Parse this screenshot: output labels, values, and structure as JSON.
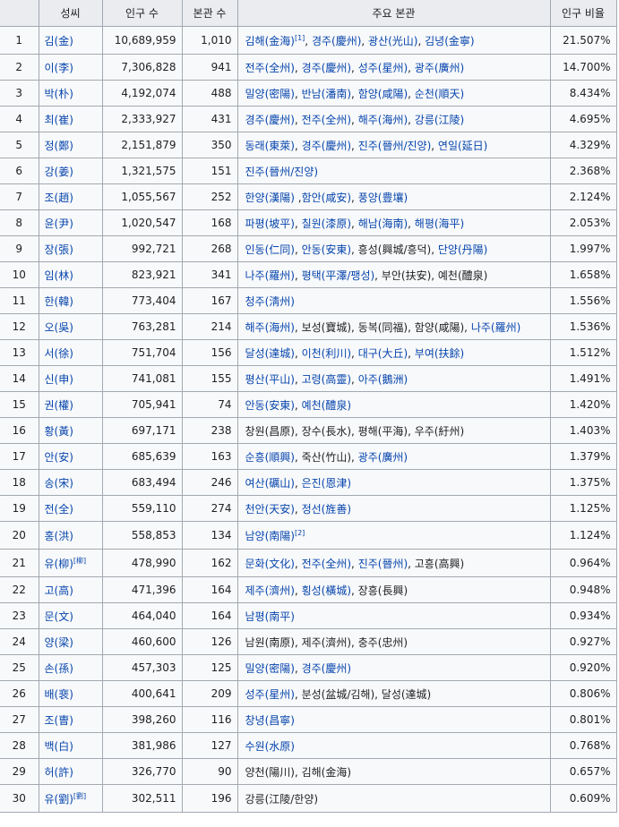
{
  "headers": {
    "name": "성씨",
    "population": "인구 수",
    "bongwan_count": "본관 수",
    "main_bongwan": "주요 본관",
    "ratio": "인구 비율"
  },
  "rows": [
    {
      "rank": "1",
      "name": "김(金)",
      "name_link": true,
      "pop": "10,689,959",
      "bon": "1,010",
      "ratio": "21.507%",
      "main": [
        {
          "t": "김해(金海)",
          "l": true,
          "sup": "[1]"
        },
        {
          "t": ", ",
          "l": false
        },
        {
          "t": "경주(慶州)",
          "l": true
        },
        {
          "t": ", ",
          "l": false
        },
        {
          "t": "광산(光山)",
          "l": true
        },
        {
          "t": ", ",
          "l": false
        },
        {
          "t": "김녕(金寧)",
          "l": true
        }
      ]
    },
    {
      "rank": "2",
      "name": "이(李)",
      "name_link": true,
      "pop": "7,306,828",
      "bon": "941",
      "ratio": "14.700%",
      "main": [
        {
          "t": "전주(全州)",
          "l": true
        },
        {
          "t": ", ",
          "l": false
        },
        {
          "t": "경주(慶州)",
          "l": true
        },
        {
          "t": ", ",
          "l": false
        },
        {
          "t": "성주(星州)",
          "l": true
        },
        {
          "t": ", ",
          "l": false
        },
        {
          "t": "광주(廣州)",
          "l": true
        }
      ]
    },
    {
      "rank": "3",
      "name": "박(朴)",
      "name_link": true,
      "pop": "4,192,074",
      "bon": "488",
      "ratio": "8.434%",
      "main": [
        {
          "t": "밀양(密陽)",
          "l": true
        },
        {
          "t": ", ",
          "l": false
        },
        {
          "t": "반남(潘南)",
          "l": true
        },
        {
          "t": ", ",
          "l": false
        },
        {
          "t": "함양(咸陽)",
          "l": true
        },
        {
          "t": ", ",
          "l": false
        },
        {
          "t": "순천(順天)",
          "l": true
        }
      ]
    },
    {
      "rank": "4",
      "name": "최(崔)",
      "name_link": true,
      "pop": "2,333,927",
      "bon": "431",
      "ratio": "4.695%",
      "main": [
        {
          "t": "경주(慶州)",
          "l": true
        },
        {
          "t": ", ",
          "l": false
        },
        {
          "t": "전주(全州)",
          "l": true
        },
        {
          "t": ", ",
          "l": false
        },
        {
          "t": "해주(海州)",
          "l": true
        },
        {
          "t": ", ",
          "l": false
        },
        {
          "t": "강릉(江陵)",
          "l": true
        }
      ]
    },
    {
      "rank": "5",
      "name": "정(鄭)",
      "name_link": true,
      "pop": "2,151,879",
      "bon": "350",
      "ratio": "4.329%",
      "main": [
        {
          "t": "동래(東萊)",
          "l": true
        },
        {
          "t": ", ",
          "l": false
        },
        {
          "t": "경주(慶州)",
          "l": true
        },
        {
          "t": ", ",
          "l": false
        },
        {
          "t": "진주(晉州/진양)",
          "l": true
        },
        {
          "t": ", ",
          "l": false
        },
        {
          "t": "연일(延日)",
          "l": true
        }
      ]
    },
    {
      "rank": "6",
      "name": "강(姜)",
      "name_link": true,
      "pop": "1,321,575",
      "bon": "151",
      "ratio": "2.368%",
      "main": [
        {
          "t": "진주(晉州/진양)",
          "l": true
        }
      ]
    },
    {
      "rank": "7",
      "name": "조(趙)",
      "name_link": true,
      "pop": "1,055,567",
      "bon": "252",
      "ratio": "2.124%",
      "main": [
        {
          "t": "한양(漢陽)",
          "l": true
        },
        {
          "t": " ,",
          "l": false
        },
        {
          "t": "함안(咸安)",
          "l": true
        },
        {
          "t": ", ",
          "l": false
        },
        {
          "t": "풍양(豊壤)",
          "l": true
        }
      ]
    },
    {
      "rank": "8",
      "name": "윤(尹)",
      "name_link": true,
      "pop": "1,020,547",
      "bon": "168",
      "ratio": "2.053%",
      "main": [
        {
          "t": "파평(坡平)",
          "l": true
        },
        {
          "t": ", ",
          "l": false
        },
        {
          "t": "칠원(漆原)",
          "l": true
        },
        {
          "t": ", ",
          "l": false
        },
        {
          "t": "해남(海南)",
          "l": true
        },
        {
          "t": ", ",
          "l": false
        },
        {
          "t": "해평(海平)",
          "l": true
        }
      ]
    },
    {
      "rank": "9",
      "name": "장(張)",
      "name_link": true,
      "pop": "992,721",
      "bon": "268",
      "ratio": "1.997%",
      "main": [
        {
          "t": "인동(仁同)",
          "l": true
        },
        {
          "t": ", ",
          "l": false
        },
        {
          "t": "안동(安東)",
          "l": true
        },
        {
          "t": ", 흥성(興城/흥덕), ",
          "l": false
        },
        {
          "t": "단양(丹陽)",
          "l": true
        }
      ]
    },
    {
      "rank": "10",
      "name": "임(林)",
      "name_link": true,
      "pop": "823,921",
      "bon": "341",
      "ratio": "1.658%",
      "main": [
        {
          "t": "나주(羅州)",
          "l": true
        },
        {
          "t": ", ",
          "l": false
        },
        {
          "t": "평택(平澤/팽성)",
          "l": true
        },
        {
          "t": ", 부안(扶安), 예천(醴泉)",
          "l": false
        }
      ]
    },
    {
      "rank": "11",
      "name": "한(韓)",
      "name_link": true,
      "pop": "773,404",
      "bon": "167",
      "ratio": "1.556%",
      "main": [
        {
          "t": "청주(淸州)",
          "l": true
        }
      ]
    },
    {
      "rank": "12",
      "name": "오(吳)",
      "name_link": true,
      "pop": "763,281",
      "bon": "214",
      "ratio": "1.536%",
      "main": [
        {
          "t": "해주(海州)",
          "l": true
        },
        {
          "t": ", 보성(寶城), 동복(同福), 함양(咸陽), ",
          "l": false
        },
        {
          "t": "나주(羅州)",
          "l": true
        }
      ]
    },
    {
      "rank": "13",
      "name": "서(徐)",
      "name_link": true,
      "pop": "751,704",
      "bon": "156",
      "ratio": "1.512%",
      "main": [
        {
          "t": "달성(達城)",
          "l": true
        },
        {
          "t": ", ",
          "l": false
        },
        {
          "t": "이천(利川)",
          "l": true
        },
        {
          "t": ", ",
          "l": false
        },
        {
          "t": "대구(大丘)",
          "l": true
        },
        {
          "t": ", ",
          "l": false
        },
        {
          "t": "부여(扶餘)",
          "l": true
        }
      ]
    },
    {
      "rank": "14",
      "name": "신(申)",
      "name_link": true,
      "pop": "741,081",
      "bon": "155",
      "ratio": "1.491%",
      "main": [
        {
          "t": "평산(平山)",
          "l": true
        },
        {
          "t": ", ",
          "l": false
        },
        {
          "t": "고령(高靈)",
          "l": true
        },
        {
          "t": ", ",
          "l": false
        },
        {
          "t": "아주(鵝洲)",
          "l": true
        }
      ]
    },
    {
      "rank": "15",
      "name": "권(權)",
      "name_link": true,
      "pop": "705,941",
      "bon": "74",
      "ratio": "1.420%",
      "main": [
        {
          "t": "안동(安東)",
          "l": true
        },
        {
          "t": ", ",
          "l": false
        },
        {
          "t": "예천(醴泉)",
          "l": true
        }
      ]
    },
    {
      "rank": "16",
      "name": "황(黃)",
      "name_link": true,
      "pop": "697,171",
      "bon": "238",
      "ratio": "1.403%",
      "main": [
        {
          "t": "창원(昌原), 장수(長水), 평해(平海), 우주(紆州)",
          "l": false
        }
      ]
    },
    {
      "rank": "17",
      "name": "안(安)",
      "name_link": true,
      "pop": "685,639",
      "bon": "163",
      "ratio": "1.379%",
      "main": [
        {
          "t": "순흥(順興)",
          "l": true
        },
        {
          "t": ", 죽산(竹山), ",
          "l": false
        },
        {
          "t": "광주(廣州)",
          "l": true
        }
      ]
    },
    {
      "rank": "18",
      "name": "송(宋)",
      "name_link": true,
      "pop": "683,494",
      "bon": "246",
      "ratio": "1.375%",
      "main": [
        {
          "t": "여산(礪山)",
          "l": true
        },
        {
          "t": ", ",
          "l": false
        },
        {
          "t": "은진(恩津)",
          "l": true
        }
      ]
    },
    {
      "rank": "19",
      "name": "전(全)",
      "name_link": true,
      "pop": "559,110",
      "bon": "274",
      "ratio": "1.125%",
      "main": [
        {
          "t": "천안(天安)",
          "l": true
        },
        {
          "t": ", ",
          "l": false
        },
        {
          "t": "정선(旌善)",
          "l": true
        }
      ]
    },
    {
      "rank": "20",
      "name": "홍(洪)",
      "name_link": true,
      "pop": "558,853",
      "bon": "134",
      "ratio": "1.124%",
      "main": [
        {
          "t": "남양(南陽)",
          "l": true,
          "sup": "[2]"
        }
      ]
    },
    {
      "rank": "21",
      "name": "유(柳)",
      "name_link": true,
      "name_sup": "[柳]",
      "pop": "478,990",
      "bon": "162",
      "ratio": "0.964%",
      "main": [
        {
          "t": "문화(文化)",
          "l": true
        },
        {
          "t": ", ",
          "l": false
        },
        {
          "t": "전주(全州)",
          "l": true
        },
        {
          "t": ", ",
          "l": false
        },
        {
          "t": "진주(晉州)",
          "l": true
        },
        {
          "t": ", 고흥(高興)",
          "l": false
        }
      ]
    },
    {
      "rank": "22",
      "name": "고(高)",
      "name_link": true,
      "pop": "471,396",
      "bon": "164",
      "ratio": "0.948%",
      "main": [
        {
          "t": "제주(濟州)",
          "l": true
        },
        {
          "t": ", ",
          "l": false
        },
        {
          "t": "횡성(橫城)",
          "l": true
        },
        {
          "t": ", 장흥(長興)",
          "l": false
        }
      ]
    },
    {
      "rank": "23",
      "name": "문(文)",
      "name_link": true,
      "pop": "464,040",
      "bon": "164",
      "ratio": "0.934%",
      "main": [
        {
          "t": "남평(南平)",
          "l": true
        }
      ]
    },
    {
      "rank": "24",
      "name": "양(梁)",
      "name_link": true,
      "pop": "460,600",
      "bon": "126",
      "ratio": "0.927%",
      "main": [
        {
          "t": "남원(南原), 제주(濟州), 충주(忠州)",
          "l": false
        }
      ]
    },
    {
      "rank": "25",
      "name": "손(孫)",
      "name_link": true,
      "pop": "457,303",
      "bon": "125",
      "ratio": "0.920%",
      "main": [
        {
          "t": "밀양(密陽)",
          "l": true
        },
        {
          "t": ", ",
          "l": false
        },
        {
          "t": "경주(慶州)",
          "l": true
        }
      ]
    },
    {
      "rank": "26",
      "name": "배(裵)",
      "name_link": true,
      "pop": "400,641",
      "bon": "209",
      "ratio": "0.806%",
      "main": [
        {
          "t": "성주(星州)",
          "l": true
        },
        {
          "t": ", 분성(盆城/김해), 달성(達城)",
          "l": false
        }
      ]
    },
    {
      "rank": "27",
      "name": "조(曺)",
      "name_link": true,
      "pop": "398,260",
      "bon": "116",
      "ratio": "0.801%",
      "main": [
        {
          "t": "창녕(昌寧)",
          "l": true
        }
      ]
    },
    {
      "rank": "28",
      "name": "백(白)",
      "name_link": true,
      "pop": "381,986",
      "bon": "127",
      "ratio": "0.768%",
      "main": [
        {
          "t": "수원(水原)",
          "l": true
        }
      ]
    },
    {
      "rank": "29",
      "name": "허(許)",
      "name_link": true,
      "pop": "326,770",
      "bon": "90",
      "ratio": "0.657%",
      "main": [
        {
          "t": "양천(陽川), 김해(金海)",
          "l": false
        }
      ]
    },
    {
      "rank": "30",
      "name": "유(劉)",
      "name_link": true,
      "name_sup": "[劉]",
      "pop": "302,511",
      "bon": "196",
      "ratio": "0.609%",
      "main": [
        {
          "t": "강릉(江陵/한양)",
          "l": false
        }
      ]
    }
  ],
  "colors": {
    "link": "#0645ad",
    "header_bg": "#eaecf0",
    "cell_bg": "#f8f9fa",
    "border": "#a2a9b1"
  }
}
